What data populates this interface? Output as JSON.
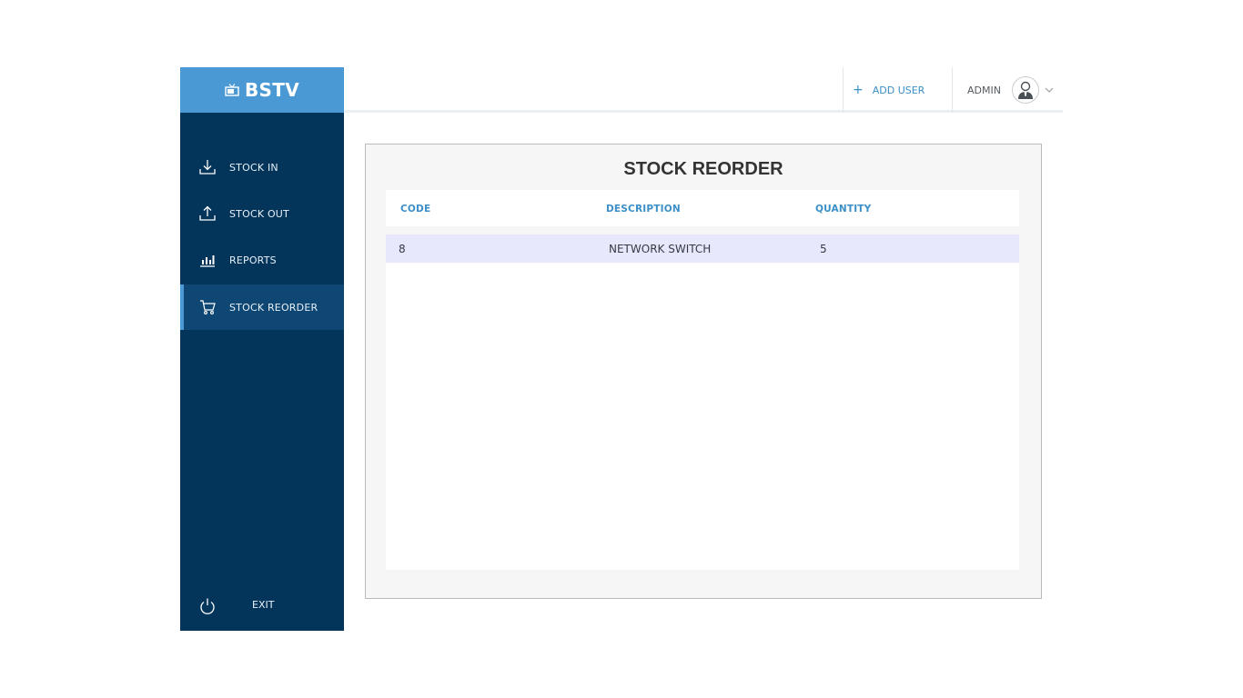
{
  "brand": {
    "name": "BSTV"
  },
  "sidebar": {
    "items": [
      {
        "label": "STOCK IN",
        "icon": "download-icon",
        "active": false
      },
      {
        "label": "STOCK OUT",
        "icon": "upload-icon",
        "active": false
      },
      {
        "label": "REPORTS",
        "icon": "bar-chart-icon",
        "active": false
      },
      {
        "label": "STOCK REORDER",
        "icon": "cart-icon",
        "active": true
      }
    ],
    "exit_label": "EXIT"
  },
  "header": {
    "add_user_label": "ADD USER",
    "user_label": "ADMIN"
  },
  "main": {
    "title": "STOCK REORDER",
    "columns": [
      "CODE",
      "DESCRIPTION",
      "QUANTITY"
    ],
    "rows": [
      {
        "code": "8",
        "description": "NETWORK SWITCH",
        "quantity": "5"
      }
    ]
  },
  "colors": {
    "sidebar": "#03345a",
    "brand": "#4a98d4",
    "active_item": "#0f4774",
    "accent": "#3a8fc8",
    "selected_row": "#e8e8fc"
  }
}
